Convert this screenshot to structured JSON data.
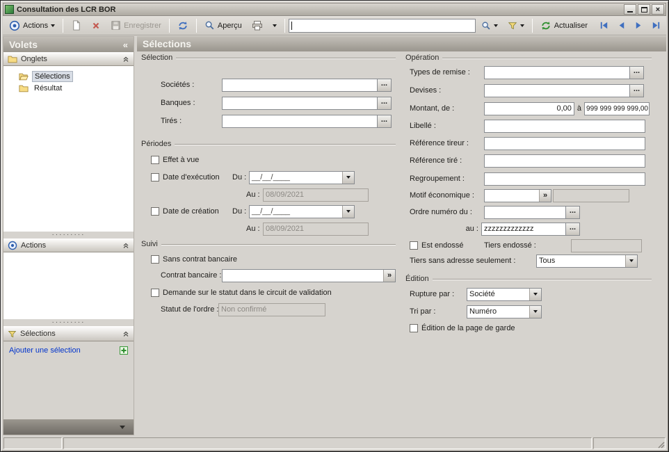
{
  "window": {
    "title": "Consultation des LCR BOR"
  },
  "glyphs": {
    "ellipsis": "...",
    "double_chevron": "»",
    "collapse": "«",
    "close": "×",
    "dots": "·········"
  },
  "toolbar": {
    "actions": "Actions",
    "enregistrer": "Enregistrer",
    "apercu": "Aperçu",
    "actualiser": "Actualiser",
    "search_value": ""
  },
  "sidebar": {
    "title": "Volets",
    "onglets_header": "Onglets",
    "actions_header": "Actions",
    "selections_header": "Sélections",
    "tree": [
      {
        "label": "Sélections"
      },
      {
        "label": "Résultat"
      }
    ],
    "add_selection": "Ajouter une sélection"
  },
  "main": {
    "title": "Sélections",
    "selection": {
      "title": "Sélection",
      "societes": "Sociétés :",
      "banques": "Banques :",
      "tires": "Tirés :"
    },
    "periodes": {
      "title": "Périodes",
      "effet_a_vue": "Effet à vue",
      "date_execution": "Date d'exécution",
      "date_creation": "Date de création",
      "du": "Du :",
      "au": "Au :",
      "date_mask": "__/__/____",
      "au_value": "08/09/2021"
    },
    "suivi": {
      "title": "Suivi",
      "sans_contrat": "Sans contrat bancaire",
      "contrat": "Contrat bancaire :",
      "demande_statut": "Demande sur le statut dans le circuit de validation",
      "statut": "Statut de l'ordre :",
      "statut_value": "Non confirmé"
    },
    "operation": {
      "title": "Opération",
      "types_remise": "Types de remise :",
      "devises": "Devises :",
      "montant": "Montant, de :",
      "montant_de": "0,00",
      "a": "à",
      "montant_a": "999 999 999 999,00",
      "libelle": "Libellé :",
      "ref_tireur": "Référence tireur :",
      "ref_tire": "Référence tiré :",
      "regroupement": "Regroupement :",
      "motif": "Motif économique :",
      "ordre_du": "Ordre numéro du :",
      "ordre_au": "au :",
      "ordre_au_value": "zzzzzzzzzzzzz",
      "est_endosse": "Est endossé",
      "tiers_endosse": "Tiers endossé :",
      "tiers_sans_adresse": "Tiers sans adresse seulement :",
      "tiers_sans_adresse_value": "Tous"
    },
    "edition": {
      "title": "Édition",
      "rupture": "Rupture par :",
      "rupture_value": "Société",
      "tri": "Tri par :",
      "tri_value": "Numéro",
      "page_garde": "Édition de la page de garde"
    }
  }
}
